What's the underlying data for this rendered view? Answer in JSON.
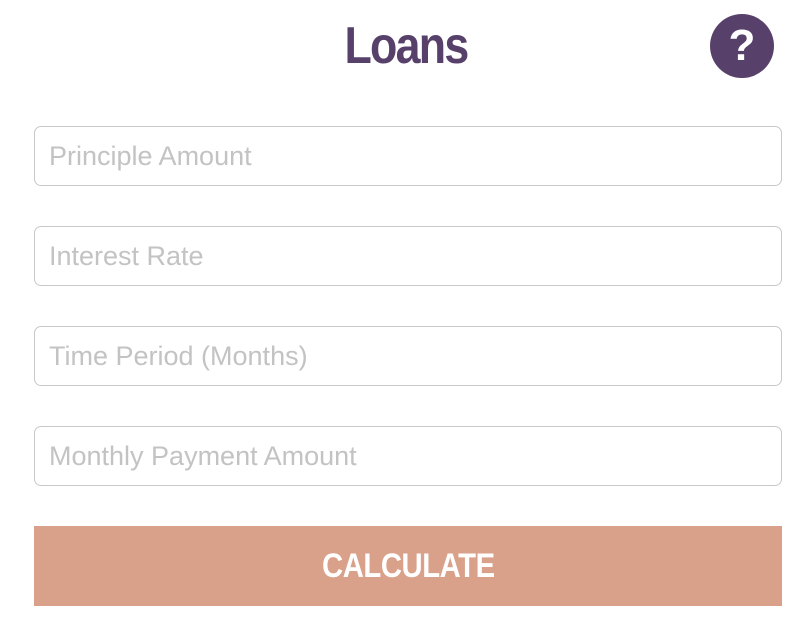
{
  "header": {
    "title": "Loans",
    "help_label": "?"
  },
  "form": {
    "fields": [
      {
        "placeholder": "Principle Amount",
        "value": ""
      },
      {
        "placeholder": "Interest Rate",
        "value": ""
      },
      {
        "placeholder": "Time Period (Months)",
        "value": ""
      },
      {
        "placeholder": "Monthly Payment Amount",
        "value": ""
      }
    ],
    "calculate_label": "CALCULATE"
  },
  "colors": {
    "title": "#574069",
    "help_button_bg": "#574069",
    "calculate_bg": "#d9a18a",
    "field_border": "#c9c9c9",
    "placeholder": "#c3c3c3"
  },
  "icons": {
    "help": "question-mark-icon"
  }
}
